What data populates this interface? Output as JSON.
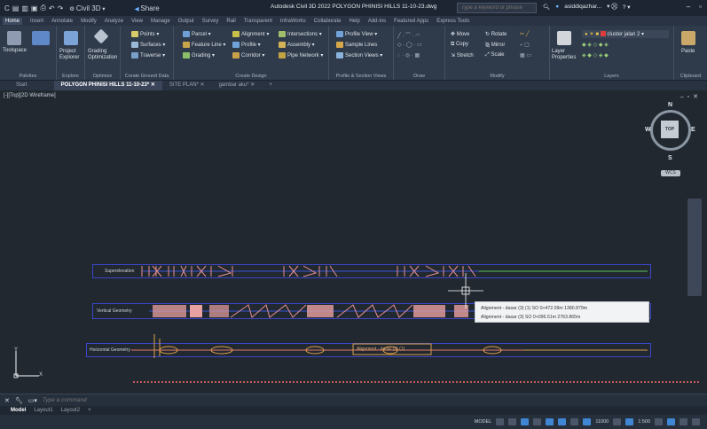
{
  "titlebar": {
    "title": "Autodesk Civil 3D 2022   POLYGON PHINISI HILLS 11-10-23.dwg",
    "workspace": "Civil 3D",
    "share": "Share",
    "search_placeholder": "Type a keyword or phrase",
    "user": "asiddiqazhar..."
  },
  "menu_tabs": [
    "Home",
    "Insert",
    "Annotate",
    "Modify",
    "Analyze",
    "View",
    "Manage",
    "Output",
    "Survey",
    "Rail",
    "Transparent",
    "InfraWorks",
    "Collaborate",
    "Help",
    "Add-ins",
    "Featured Apps",
    "Express Tools"
  ],
  "ribbon": {
    "toolspace": "Toolspace",
    "project_explorer": "Project Explorer",
    "grading_optimization": "Grading Optimization",
    "points": "Points",
    "surfaces": "Surfaces",
    "traverse": "Traverse",
    "parcel": "Parcel",
    "feature_line": "Feature Line",
    "grading": "Grading",
    "alignment": "Alignment",
    "profile": "Profile",
    "corridor": "Corridor",
    "intersections": "Intersections",
    "assembly": "Assembly",
    "pipe_network": "Pipe Network",
    "profile_view": "Profile View",
    "sample_lines": "Sample Lines",
    "section_views": "Section Views",
    "move": "Move",
    "copy": "Copy",
    "stretch": "Stretch",
    "rotate": "Rotate",
    "mirror": "Mirror",
    "scale": "Scale",
    "layer_properties": "Layer Properties",
    "layer_name": "cluster jalan 2",
    "paste": "Paste",
    "panels": [
      "Palettes",
      "Explore",
      "Optimize",
      "Create Ground Data",
      "Create Design",
      "Profile & Section Views",
      "Draw",
      "Modify",
      "Layers",
      "Clipboard"
    ]
  },
  "doc_tabs": [
    "Start",
    "POLYGON PHINISI HILLS 11-10-23*",
    "SITE PLAN*",
    "gambar aku*"
  ],
  "viewport": {
    "label": "[-][Top][2D Wireframe]",
    "compass": {
      "n": "N",
      "s": "S",
      "e": "E",
      "w": "W",
      "top": "TOP",
      "wcs": "WCS"
    },
    "track_labels": [
      "Superelevation",
      "Vertical Geometry",
      "Horizontal Geometry"
    ],
    "tooltip": {
      "row1": "Alignment - dasar (3) (1)   SO   0+472.09m   1380.879m",
      "row2": "Alignment - dasar (3)   SO   0+096.51m   2763.865m"
    },
    "mid_label": "Alignment - dasar (3) (1)",
    "ucs_x": "X",
    "ucs_y": "Y"
  },
  "command": {
    "placeholder": "Type a command"
  },
  "layout_tabs": [
    "Model",
    "Layout1",
    "Layout2",
    "+"
  ],
  "status": {
    "model": "MODEL",
    "scale": "1:500",
    "coords": "11000"
  }
}
